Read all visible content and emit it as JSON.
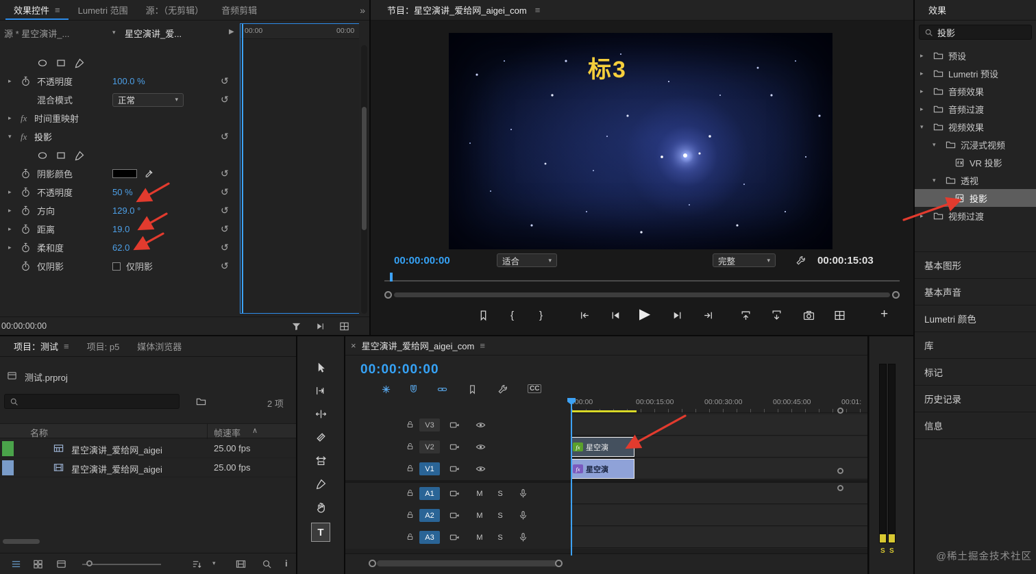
{
  "icons": {
    "menu": "≡",
    "overflow": "»",
    "close": "×",
    "chevron_right": "▸",
    "chevron_down": "▾",
    "reset": "↺",
    "play": "▶",
    "collapse": "▶",
    "mark_in": "{",
    "mark_out": "}",
    "plus": "+",
    "fx": "fx",
    "sort_asc": "∧",
    "info": "i"
  },
  "colors": {
    "accent_blue": "#2d8ceb",
    "value_blue": "#4da0e8",
    "timecode_blue": "#36a3f7",
    "overlay_yellow": "#f6cf3c",
    "arrow_red": "#e23b2e",
    "workarea_yellow": "#d9d927",
    "track_label_blue": "#2a6496",
    "clip_v1_bg": "#8fa2d8",
    "clip_v2_bg": "#44505e",
    "fx_badge_green": "#5aa02c",
    "fx_badge_purple": "#7a5bbf",
    "meter_yellow": "#d8c832"
  },
  "effect_controls": {
    "tabs": [
      "效果控件",
      "Lumetri 范围",
      "源：（无剪辑）",
      "音频剪辑"
    ],
    "source_label": "源 * 星空演讲_...",
    "clip_selector": "星空演讲_爱...",
    "ruler_start": "00:00",
    "ruler_end": "00:00",
    "rows": {
      "opacity_label": "不透明度",
      "opacity_value": "100.0 %",
      "blend_label": "混合模式",
      "blend_value": "正常",
      "time_remap_label": "时间重映射",
      "shadow_group_label": "投影",
      "shadow_color_label": "阴影颜色",
      "shadow_color": "#000000",
      "shadow_opacity_label": "不透明度",
      "shadow_opacity_value": "50 %",
      "direction_label": "方向",
      "direction_value": "129.0 °",
      "distance_label": "距离",
      "distance_value": "19.0",
      "softness_label": "柔和度",
      "softness_value": "62.0",
      "shadow_only_label": "仅阴影",
      "shadow_only_checkbox_label": "仅阴影"
    },
    "footer_timecode": "00:00:00:00"
  },
  "program": {
    "title": "节目：星空演讲_爱给网_aigei_com",
    "overlay_text": "标3",
    "timecode": "00:00:00:00",
    "zoom_level": "适合",
    "playback_resolution": "完整",
    "duration": "00:00:15:03"
  },
  "effects_panel": {
    "title": "效果",
    "search_value": "投影",
    "tree": [
      "预设",
      "Lumetri 预设",
      "音频效果",
      "音频过渡",
      "视频效果",
      "沉浸式视频",
      "VR 投影",
      "透视",
      "投影",
      "视频过渡"
    ],
    "buttons": [
      "基本图形",
      "基本声音",
      "Lumetri 颜色",
      "库",
      "标记",
      "历史记录",
      "信息"
    ]
  },
  "project_panel": {
    "tabs": [
      "项目：测试",
      "项目: p5",
      "媒体浏览器"
    ],
    "project_file": "测试.prproj",
    "item_count": "2 项",
    "col_name": "名称",
    "col_fps": "帧速率",
    "items": [
      {
        "name": "星空演讲_爱给网_aigei",
        "fps": "25.00 fps",
        "label_color": "#4aa34a"
      },
      {
        "name": "星空演讲_爱给网_aigei",
        "fps": "25.00 fps",
        "label_color": "#7a9cc9"
      }
    ]
  },
  "tools": {
    "type_label": "T"
  },
  "timeline": {
    "tab_title": "星空演讲_爱给网_aigei_com",
    "timecode": "00:00:00:00",
    "ruler_labels": [
      ":00:00",
      "00:00:15:00",
      "00:00:30:00",
      "00:00:45:00",
      "00:01:"
    ],
    "video_tracks": [
      "V3",
      "V2",
      "V1"
    ],
    "audio_tracks": [
      "A1",
      "A2",
      "A3"
    ],
    "clips": [
      {
        "label": "星空演"
      },
      {
        "label": "星空演"
      }
    ],
    "mute": "M",
    "solo": "S",
    "cc": "CC"
  },
  "audio_meter": {
    "solo_left": "S",
    "solo_right": "S"
  },
  "watermark": "@稀土掘金技术社区"
}
